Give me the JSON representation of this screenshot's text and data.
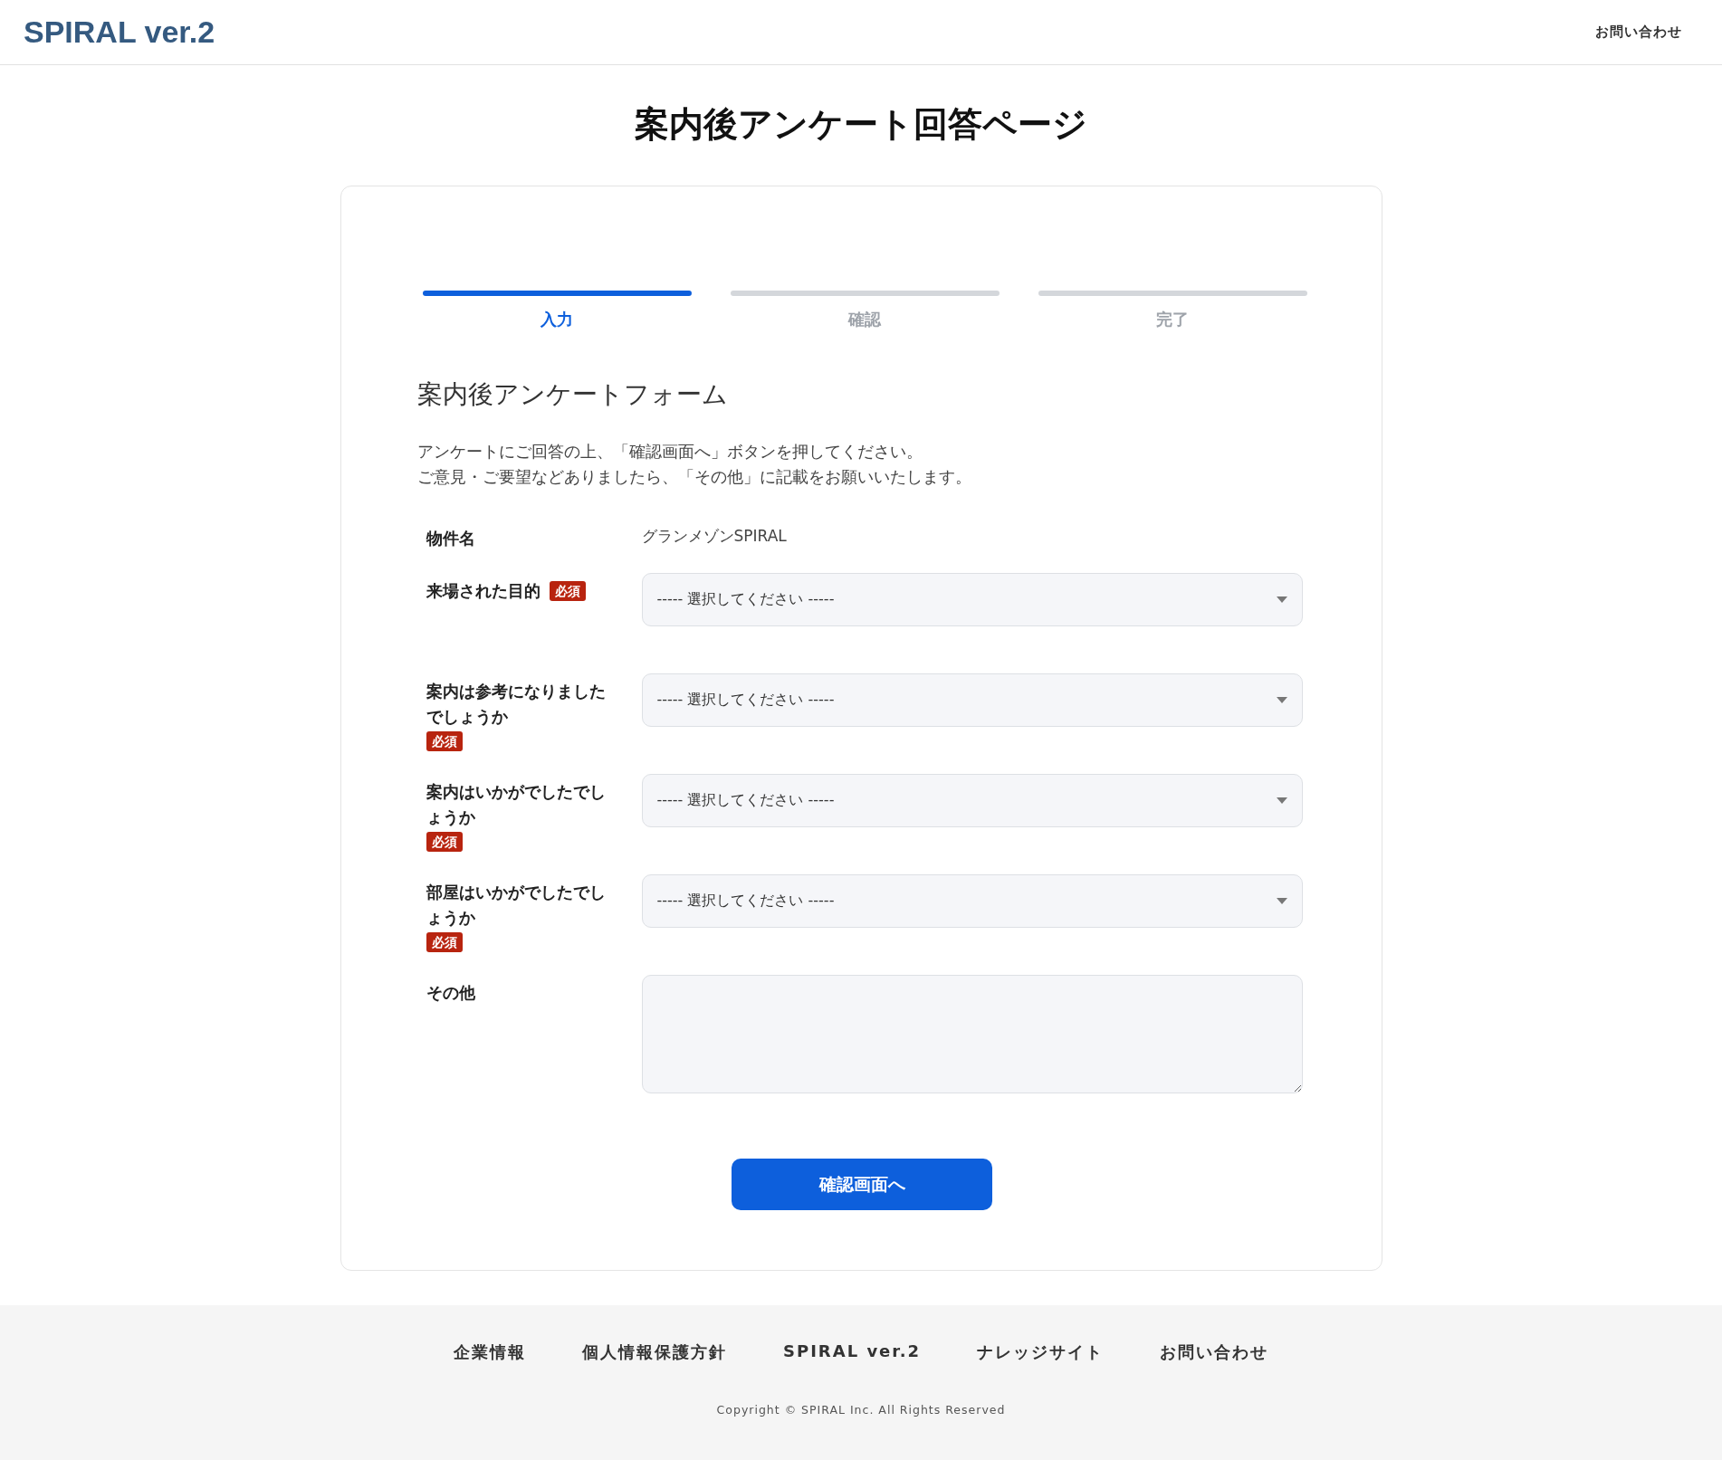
{
  "header": {
    "logo": "SPIRAL ver.2",
    "link": "お問い合わせ"
  },
  "page_title": "案内後アンケート回答ページ",
  "steps": [
    {
      "label": "入力",
      "selected": true
    },
    {
      "label": "確認",
      "selected": false
    },
    {
      "label": "完了",
      "selected": false
    }
  ],
  "form": {
    "title": "案内後アンケートフォーム",
    "description": [
      "アンケートにご回答の上、「確認画面へ」ボタンを押してください。",
      "ご意見・ご要望などありましたら、「その他」に記載をお願いいたします。"
    ],
    "fields": [
      {
        "kind": "text",
        "label": "物件名",
        "value": "グランメゾンSPIRAL"
      },
      {
        "kind": "select",
        "label": "来場された目的",
        "badge": "必須",
        "placeholder": "----- 選択してください -----"
      },
      {
        "kind": "select",
        "label": "案内は参考になりましたでしょうか",
        "badge": "必須",
        "placeholder": "----- 選択してください -----"
      },
      {
        "kind": "select",
        "label": "案内はいかがでしたでしょうか",
        "badge": "必須",
        "placeholder": "----- 選択してください -----"
      },
      {
        "kind": "select",
        "label": "部屋はいかがでしたでしょうか",
        "badge": "必須",
        "placeholder": "----- 選択してください -----"
      },
      {
        "kind": "textarea",
        "label": "その他"
      }
    ],
    "submit": "確認画面へ"
  },
  "footer": {
    "links": [
      "企業情報",
      "個人情報保護方針",
      "SPIRAL ver.2",
      "ナレッジサイト",
      "お問い合わせ"
    ],
    "copyright": "Copyright © SPIRAL Inc. All Rights Reserved"
  }
}
